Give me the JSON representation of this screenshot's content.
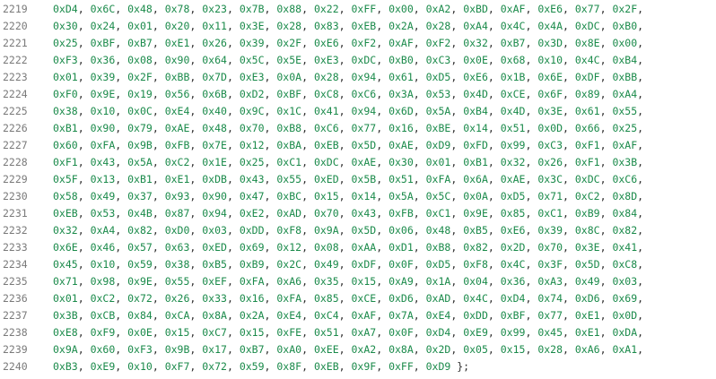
{
  "editor": {
    "lines": [
      {
        "number": "2219",
        "values": [
          "0xD4",
          "0x6C",
          "0x48",
          "0x78",
          "0x23",
          "0x7B",
          "0x88",
          "0x22",
          "0xFF",
          "0x00",
          "0xA2",
          "0xBD",
          "0xAF",
          "0xE6",
          "0x77",
          "0x2F"
        ],
        "end": ","
      },
      {
        "number": "2220",
        "values": [
          "0x30",
          "0x24",
          "0x01",
          "0x20",
          "0x11",
          "0x3E",
          "0x28",
          "0x83",
          "0xEB",
          "0x2A",
          "0x28",
          "0xA4",
          "0x4C",
          "0x4A",
          "0xDC",
          "0xB0"
        ],
        "end": ","
      },
      {
        "number": "2221",
        "values": [
          "0x25",
          "0xBF",
          "0xB7",
          "0xE1",
          "0x26",
          "0x39",
          "0x2F",
          "0xE6",
          "0xF2",
          "0xAF",
          "0xF2",
          "0x32",
          "0xB7",
          "0x3D",
          "0x8E",
          "0x00"
        ],
        "end": ","
      },
      {
        "number": "2222",
        "values": [
          "0xF3",
          "0x36",
          "0x08",
          "0x90",
          "0x64",
          "0x5C",
          "0x5E",
          "0xE3",
          "0xDC",
          "0xB0",
          "0xC3",
          "0x0E",
          "0x68",
          "0x10",
          "0x4C",
          "0xB4"
        ],
        "end": ","
      },
      {
        "number": "2223",
        "values": [
          "0x01",
          "0x39",
          "0x2F",
          "0xBB",
          "0x7D",
          "0xE3",
          "0x0A",
          "0x28",
          "0x94",
          "0x61",
          "0xD5",
          "0xE6",
          "0x1B",
          "0x6E",
          "0xDF",
          "0xBB"
        ],
        "end": ","
      },
      {
        "number": "2224",
        "values": [
          "0xF0",
          "0x9E",
          "0x19",
          "0x56",
          "0x6B",
          "0xD2",
          "0xBF",
          "0xC8",
          "0xC6",
          "0x3A",
          "0x53",
          "0x4D",
          "0xCE",
          "0x6F",
          "0x89",
          "0xA4"
        ],
        "end": ","
      },
      {
        "number": "2225",
        "values": [
          "0x38",
          "0x10",
          "0x0C",
          "0xE4",
          "0x40",
          "0x9C",
          "0x1C",
          "0x41",
          "0x94",
          "0x6D",
          "0x5A",
          "0xB4",
          "0x4D",
          "0x3E",
          "0x61",
          "0x55"
        ],
        "end": ","
      },
      {
        "number": "2226",
        "values": [
          "0xB1",
          "0x90",
          "0x79",
          "0xAE",
          "0x48",
          "0x70",
          "0xB8",
          "0xC6",
          "0x77",
          "0x16",
          "0xBE",
          "0x14",
          "0x51",
          "0x0D",
          "0x66",
          "0x25"
        ],
        "end": ","
      },
      {
        "number": "2227",
        "values": [
          "0x60",
          "0xFA",
          "0x9B",
          "0xFB",
          "0x7E",
          "0x12",
          "0xBA",
          "0xEB",
          "0x5D",
          "0xAE",
          "0xD9",
          "0xFD",
          "0x99",
          "0xC3",
          "0xF1",
          "0xAF"
        ],
        "end": ","
      },
      {
        "number": "2228",
        "values": [
          "0xF1",
          "0x43",
          "0x5A",
          "0xC2",
          "0x1E",
          "0x25",
          "0xC1",
          "0xDC",
          "0xAE",
          "0x30",
          "0x01",
          "0xB1",
          "0x32",
          "0x26",
          "0xF1",
          "0x3B"
        ],
        "end": ","
      },
      {
        "number": "2229",
        "values": [
          "0x5F",
          "0x13",
          "0xB1",
          "0xE1",
          "0xDB",
          "0x43",
          "0x55",
          "0xED",
          "0x5B",
          "0x51",
          "0xFA",
          "0x6A",
          "0xAE",
          "0x3C",
          "0xDC",
          "0xC6"
        ],
        "end": ","
      },
      {
        "number": "2230",
        "values": [
          "0x58",
          "0x49",
          "0x37",
          "0x93",
          "0x90",
          "0x47",
          "0xBC",
          "0x15",
          "0x14",
          "0x5A",
          "0x5C",
          "0x0A",
          "0xD5",
          "0x71",
          "0xC2",
          "0x8D"
        ],
        "end": ","
      },
      {
        "number": "2231",
        "values": [
          "0xEB",
          "0x53",
          "0x4B",
          "0x87",
          "0x94",
          "0xE2",
          "0xAD",
          "0x70",
          "0x43",
          "0xFB",
          "0xC1",
          "0x9E",
          "0x85",
          "0xC1",
          "0xB9",
          "0x84"
        ],
        "end": ","
      },
      {
        "number": "2232",
        "values": [
          "0x32",
          "0xA4",
          "0x82",
          "0xD0",
          "0x03",
          "0xDD",
          "0xF8",
          "0x9A",
          "0x5D",
          "0x06",
          "0x48",
          "0xB5",
          "0xE6",
          "0x39",
          "0x8C",
          "0x82"
        ],
        "end": ","
      },
      {
        "number": "2233",
        "values": [
          "0x6E",
          "0x46",
          "0x57",
          "0x63",
          "0xED",
          "0x69",
          "0x12",
          "0x08",
          "0xAA",
          "0xD1",
          "0xB8",
          "0x82",
          "0x2D",
          "0x70",
          "0x3E",
          "0x41"
        ],
        "end": ","
      },
      {
        "number": "2234",
        "values": [
          "0x45",
          "0x10",
          "0x59",
          "0x38",
          "0xB5",
          "0xB9",
          "0x2C",
          "0x49",
          "0xDF",
          "0x0F",
          "0xD5",
          "0xF8",
          "0x4C",
          "0x3F",
          "0x5D",
          "0xC8"
        ],
        "end": ","
      },
      {
        "number": "2235",
        "values": [
          "0x71",
          "0x98",
          "0x9E",
          "0x55",
          "0xEF",
          "0xFA",
          "0xA6",
          "0x35",
          "0x15",
          "0xA9",
          "0x1A",
          "0x04",
          "0x36",
          "0xA3",
          "0x49",
          "0x03"
        ],
        "end": ","
      },
      {
        "number": "2236",
        "values": [
          "0x01",
          "0xC2",
          "0x72",
          "0x26",
          "0x33",
          "0x16",
          "0xFA",
          "0x85",
          "0xCE",
          "0xD6",
          "0xAD",
          "0x4C",
          "0xD4",
          "0x74",
          "0xD6",
          "0x69"
        ],
        "end": ","
      },
      {
        "number": "2237",
        "values": [
          "0x3B",
          "0xCB",
          "0x84",
          "0xCA",
          "0x8A",
          "0x2A",
          "0xE4",
          "0xC4",
          "0xAF",
          "0x7A",
          "0xE4",
          "0xDD",
          "0xBF",
          "0x77",
          "0xE1",
          "0x0D"
        ],
        "end": ","
      },
      {
        "number": "2238",
        "values": [
          "0xE8",
          "0xF9",
          "0x0E",
          "0x15",
          "0xC7",
          "0x15",
          "0xFE",
          "0x51",
          "0xA7",
          "0x0F",
          "0xD4",
          "0xE9",
          "0x99",
          "0x45",
          "0xE1",
          "0xDA"
        ],
        "end": ","
      },
      {
        "number": "2239",
        "values": [
          "0x9A",
          "0x60",
          "0xF3",
          "0x9B",
          "0x17",
          "0xB7",
          "0xA0",
          "0xEE",
          "0xA2",
          "0x8A",
          "0x2D",
          "0x05",
          "0x15",
          "0x28",
          "0xA6",
          "0xA1"
        ],
        "end": ","
      },
      {
        "number": "2240",
        "values": [
          "0xB3",
          "0xE9",
          "0x10",
          "0xF7",
          "0x72",
          "0x59",
          "0x8F",
          "0xEB",
          "0x9F",
          "0xFF",
          "0xD9"
        ],
        "end": " };"
      }
    ]
  }
}
